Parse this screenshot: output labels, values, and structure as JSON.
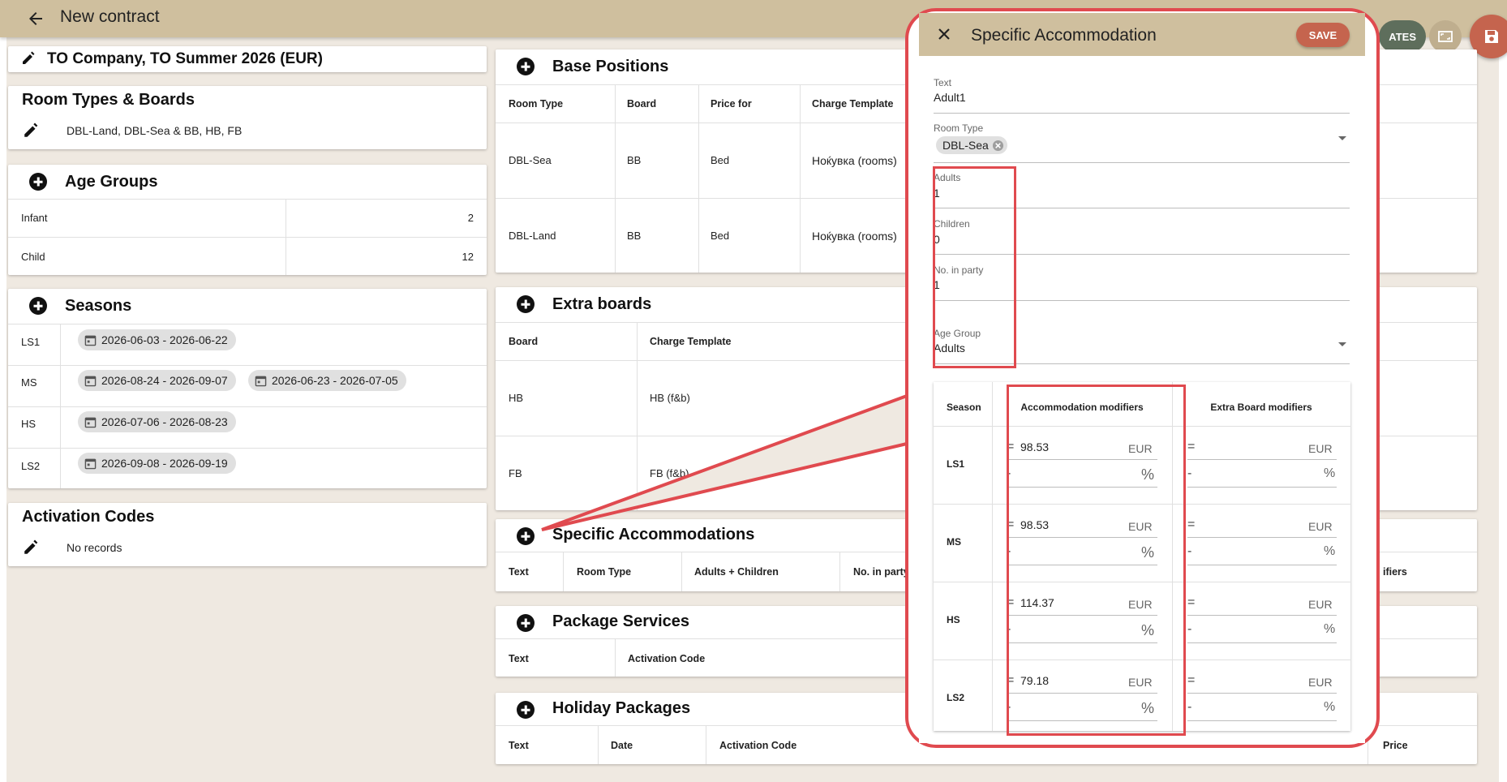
{
  "topbar": {
    "title": "New contract",
    "partial_button_label": "ATES"
  },
  "contract": {
    "title": "TO Company, TO Summer 2026 (EUR)"
  },
  "room_types": {
    "title": "Room Types & Boards",
    "value": "DBL-Land, DBL-Sea & BB, HB, FB"
  },
  "age_groups": {
    "title": "Age Groups",
    "rows": [
      {
        "name": "Infant",
        "value": "2"
      },
      {
        "name": "Child",
        "value": "12"
      }
    ]
  },
  "seasons": {
    "title": "Seasons",
    "rows": [
      {
        "name": "LS1",
        "ranges": [
          "2026-06-03 - 2026-06-22"
        ]
      },
      {
        "name": "MS",
        "ranges": [
          "2026-08-24 - 2026-09-07",
          "2026-06-23 - 2026-07-05"
        ]
      },
      {
        "name": "HS",
        "ranges": [
          "2026-07-06 - 2026-08-23"
        ]
      },
      {
        "name": "LS2",
        "ranges": [
          "2026-09-08 - 2026-09-19"
        ]
      }
    ]
  },
  "activation_codes": {
    "title": "Activation Codes",
    "empty": "No records"
  },
  "base_positions": {
    "title": "Base Positions",
    "headers": [
      "Room Type",
      "Board",
      "Price for",
      "Charge Template"
    ],
    "rows": [
      [
        "DBL-Sea",
        "BB",
        "Bed",
        "Ноќувка (rooms)"
      ],
      [
        "DBL-Land",
        "BB",
        "Bed",
        "Ноќувка (rooms)"
      ]
    ]
  },
  "extra_boards": {
    "title": "Extra boards",
    "headers": [
      "Board",
      "Charge Template"
    ],
    "rows": [
      [
        "HB",
        "HB (f&b)"
      ],
      [
        "FB",
        "FB (f&b)"
      ]
    ]
  },
  "specific_accommodations": {
    "title": "Specific Accommodations",
    "headers": [
      "Text",
      "Room Type",
      "Adults + Children",
      "No. in party"
    ],
    "partial_header": "ifiers"
  },
  "package_services": {
    "title": "Package Services",
    "headers": [
      "Text",
      "Activation Code"
    ]
  },
  "holiday_packages": {
    "title": "Holiday Packages",
    "headers": [
      "Text",
      "Date",
      "Activation Code",
      "Price"
    ]
  },
  "dialog": {
    "title": "Specific Accommodation",
    "save": "SAVE",
    "text_label": "Text",
    "text_value": "Adult1",
    "room_type_label": "Room Type",
    "room_type_chip": "DBL-Sea",
    "adults_label": "Adults",
    "adults_value": "1",
    "children_label": "Children",
    "children_value": "0",
    "party_label": "No. in party",
    "party_value": "1",
    "age_group_label": "Age Group",
    "age_group_value": "Adults",
    "table": {
      "headers": [
        "Season",
        "Accommodation modifiers",
        "Extra Board modifiers"
      ],
      "eq": "=",
      "minus": "-",
      "currency": "EUR",
      "percent": "%",
      "rows": [
        {
          "season": "LS1",
          "acc": "98.53"
        },
        {
          "season": "MS",
          "acc": "98.53"
        },
        {
          "season": "HS",
          "acc": "114.37"
        },
        {
          "season": "LS2",
          "acc": "79.18"
        }
      ]
    }
  },
  "colors": {
    "header_bg": "#cfbf9e",
    "canvas_bg": "#efe9e1",
    "save_btn": "#c5644e",
    "highlight": "#e04a4f"
  }
}
